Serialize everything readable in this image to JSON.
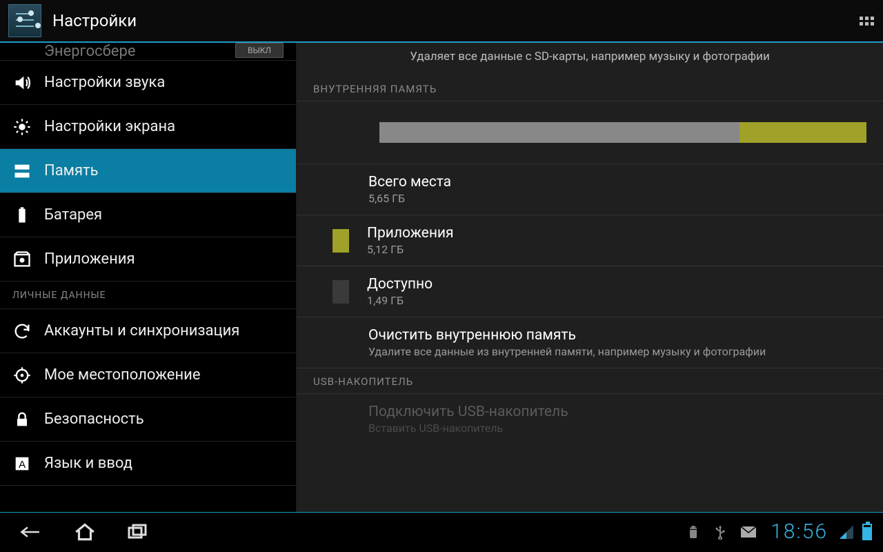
{
  "header": {
    "title": "Настройки"
  },
  "sidebar": {
    "partial_label": "Энергосбере",
    "partial_toggle": "ВЫКЛ",
    "items": [
      {
        "label": "Настройки звука"
      },
      {
        "label": "Настройки экрана"
      },
      {
        "label": "Память"
      },
      {
        "label": "Батарея"
      },
      {
        "label": "Приложения"
      }
    ],
    "section_personal": "ЛИЧНЫЕ ДАННЫЕ",
    "items2": [
      {
        "label": "Аккаунты и синхронизация"
      },
      {
        "label": "Мое местоположение"
      },
      {
        "label": "Безопасность"
      },
      {
        "label": "Язык и ввод"
      }
    ]
  },
  "content": {
    "sd_desc": "Удаляет все данные с SD-карты, например музыку и фотографии",
    "section_internal": "ВНУТРЕННЯЯ ПАМЯТЬ",
    "storage_used_pct": 74,
    "storage_apps_pct": 26,
    "total": {
      "label": "Всего места",
      "value": "5,65  ГБ"
    },
    "apps": {
      "label": "Приложения",
      "value": "5,12  ГБ"
    },
    "avail": {
      "label": "Доступно",
      "value": "1,49  ГБ"
    },
    "clear": {
      "label": "Очистить внутреннюю память",
      "desc": "Удалите все данные из внутренней памяти, например музыку и фотографии"
    },
    "section_usb": "USB-НАКОПИТЕЛЬ",
    "usb": {
      "label": "Подключить USB-накопитель",
      "desc": "Вставить USB-накопитель"
    }
  },
  "navbar": {
    "time": "18:56"
  },
  "colors": {
    "accent": "#0a7ea3",
    "apps_color": "#a0a128",
    "used_color": "#888"
  }
}
